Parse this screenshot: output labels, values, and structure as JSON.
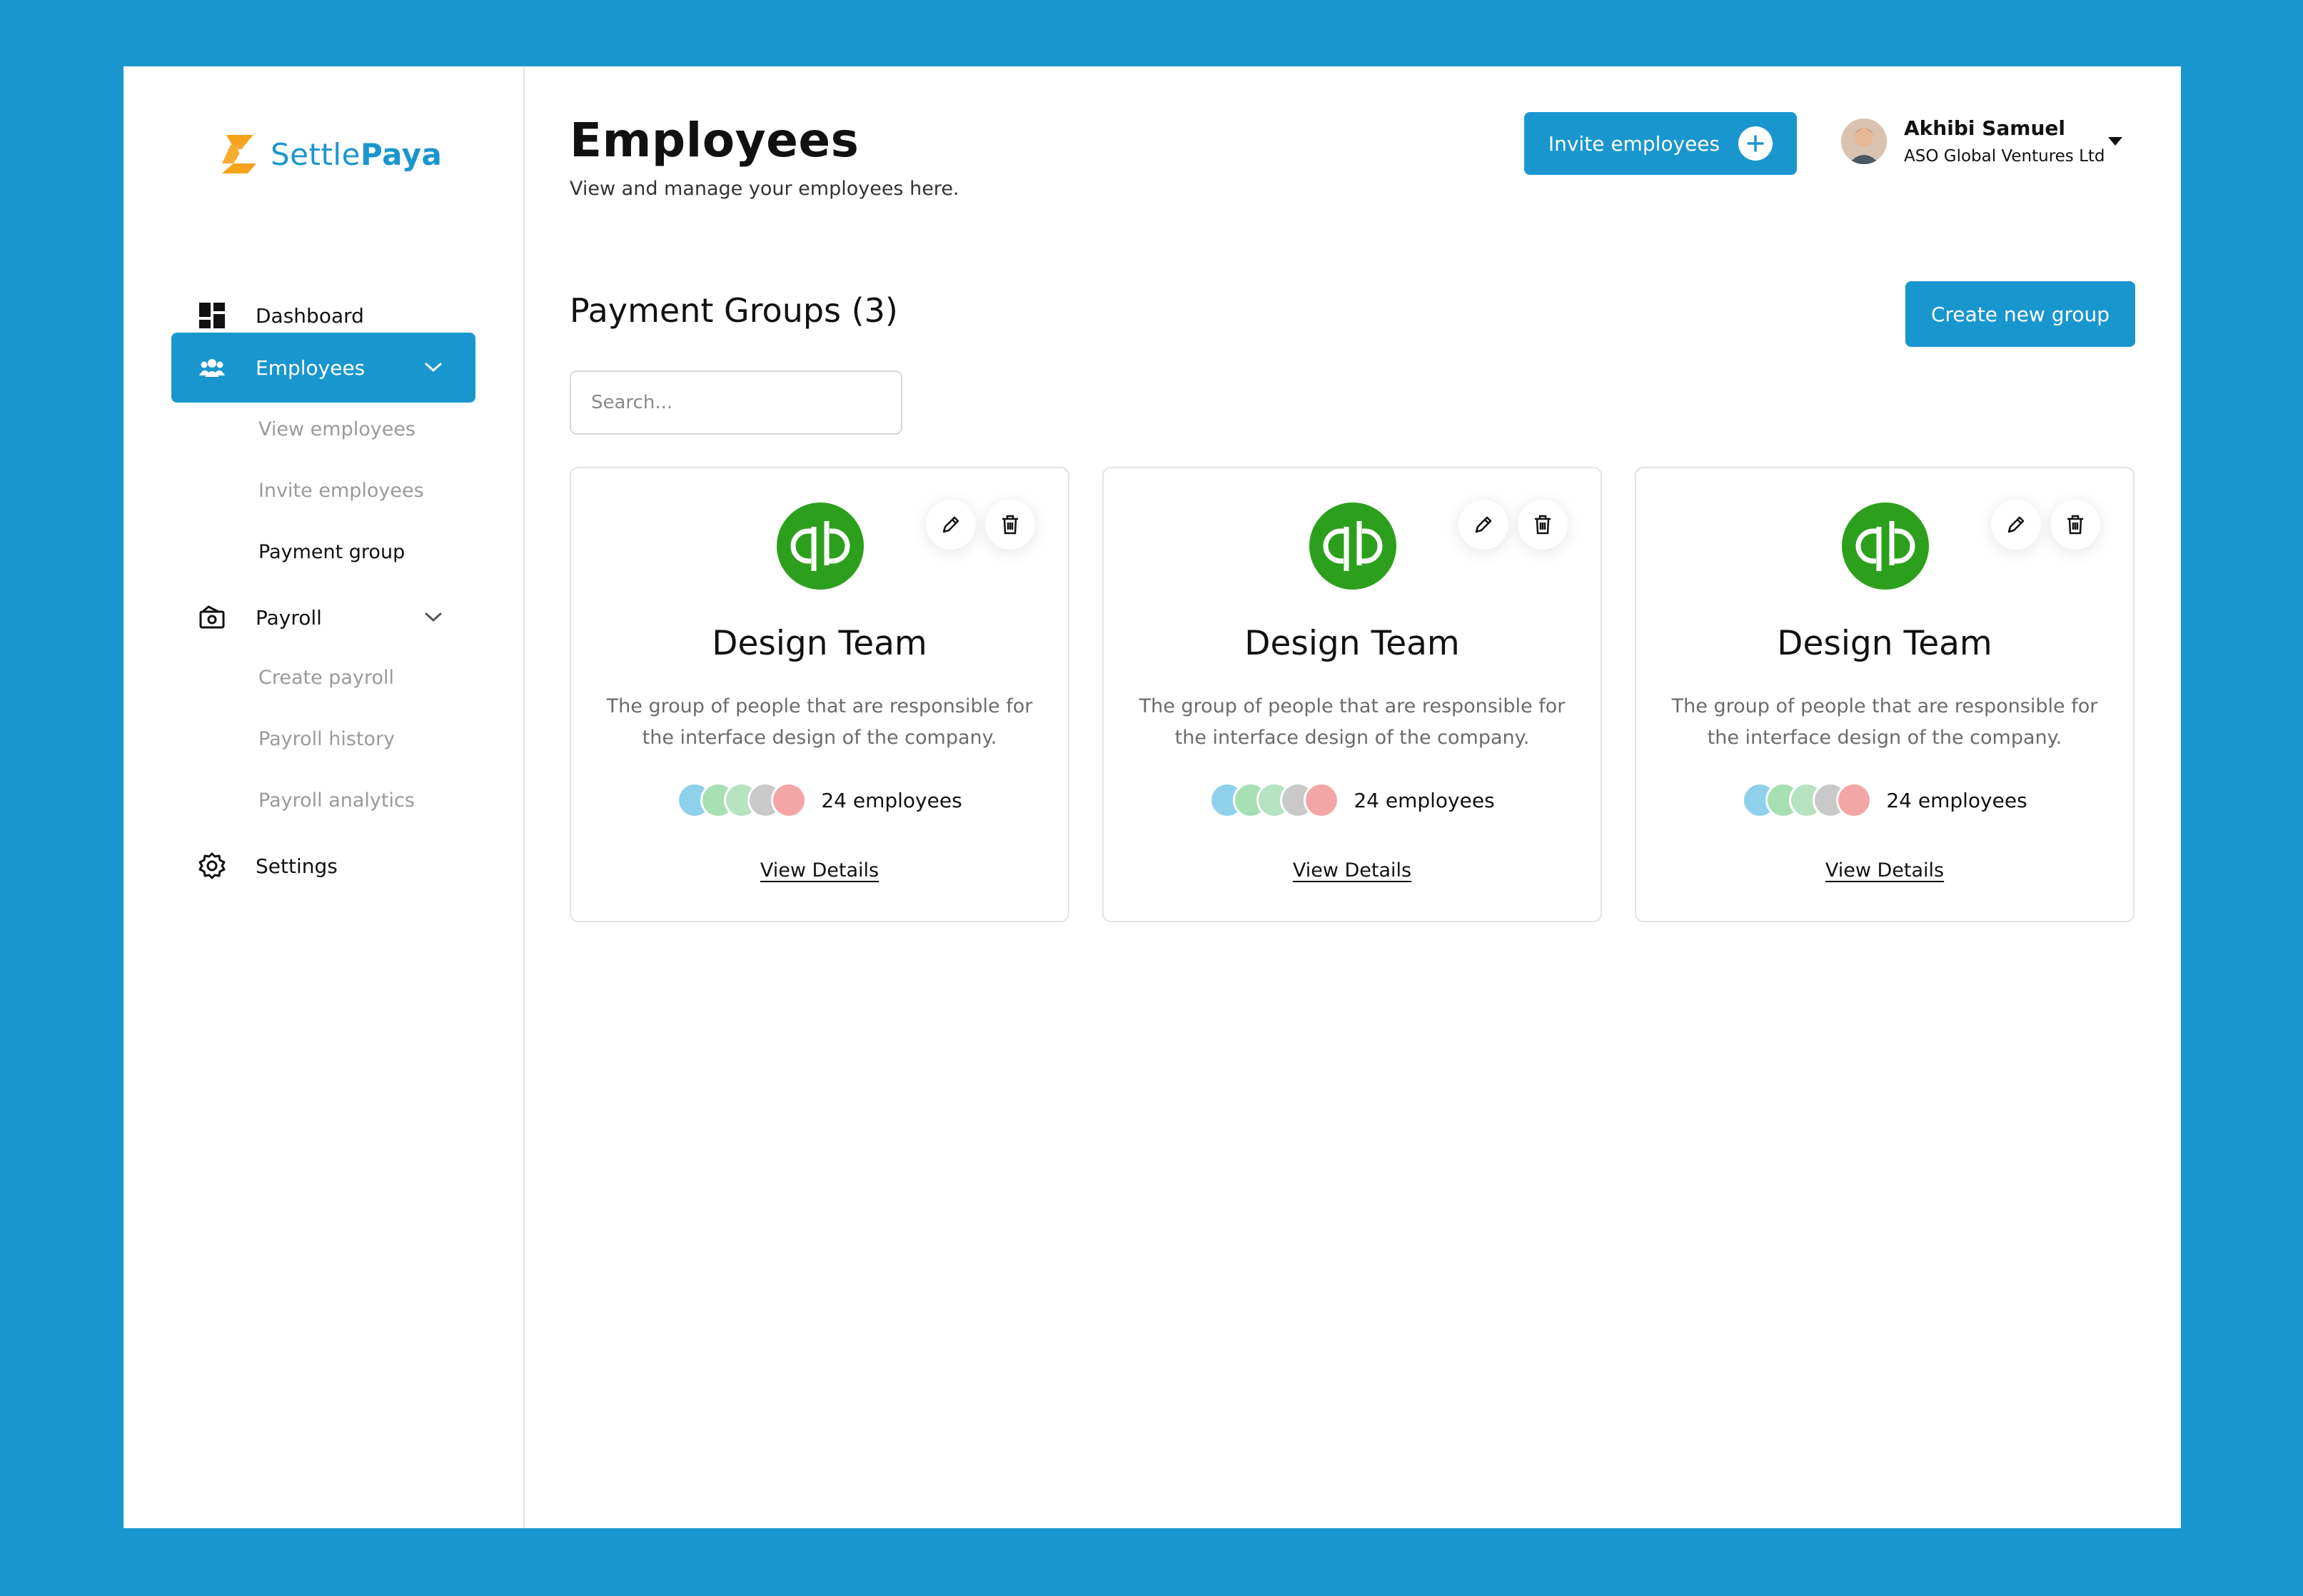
{
  "brand": {
    "name_part1": "Settle",
    "name_part2": "Paya"
  },
  "sidebar": {
    "items": [
      {
        "label": "Dashboard",
        "icon": "dashboard-grid-icon"
      },
      {
        "label": "Employees",
        "icon": "users-icon",
        "expanded": true,
        "active": true,
        "children": [
          {
            "label": "View employees"
          },
          {
            "label": "Invite employees"
          },
          {
            "label": "Payment group",
            "current": true
          }
        ]
      },
      {
        "label": "Payroll",
        "icon": "payroll-cash-icon",
        "expanded": true,
        "children": [
          {
            "label": "Create payroll"
          },
          {
            "label": "Payroll history"
          },
          {
            "label": "Payroll analytics"
          }
        ]
      },
      {
        "label": "Settings",
        "icon": "gear-icon"
      }
    ]
  },
  "header": {
    "title": "Employees",
    "subtitle": "View and manage your employees here.",
    "invite_button": "Invite employees",
    "user": {
      "name": "Akhibi Samuel",
      "org": "ASO Global Ventures Ltd"
    }
  },
  "groups": {
    "title": "Payment Groups (3)",
    "create_button": "Create new group",
    "search_placeholder": "Search...",
    "cards": [
      {
        "name": "Design Team",
        "description": "The group of people that are responsible for the interface design of the company.",
        "members": "24 employees",
        "link": "View Details"
      },
      {
        "name": "Design Team",
        "description": "The group of people that are responsible for the interface design of the company.",
        "members": "24 employees",
        "link": "View Details"
      },
      {
        "name": "Design Team",
        "description": "The group of people that are responsible for the interface design of the company.",
        "members": "24 employees",
        "link": "View Details"
      }
    ]
  },
  "colors": {
    "accent": "#1a96cf",
    "logo_orange": "#f5a31a",
    "quickbooks_green": "#2ca01c"
  }
}
